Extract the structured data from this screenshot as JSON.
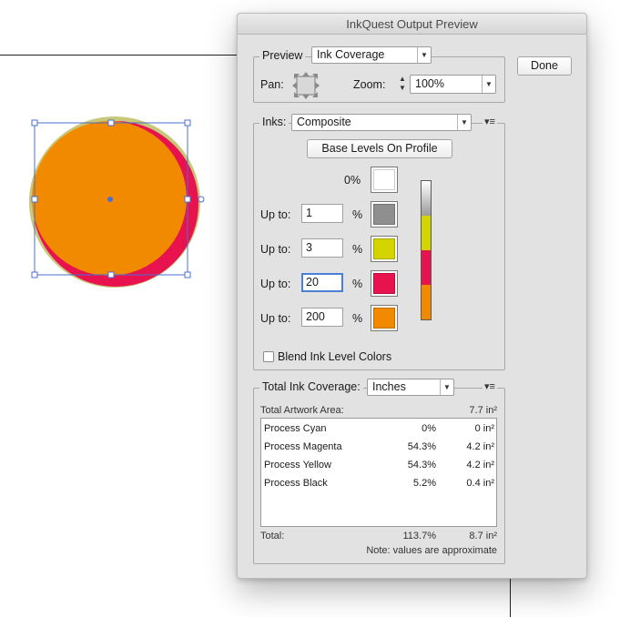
{
  "dialog": {
    "title": "InkQuest Output Preview",
    "done_label": "Done"
  },
  "preview": {
    "group_label": "Preview",
    "mode_value": "Ink Coverage",
    "pan_label": "Pan:",
    "zoom_label": "Zoom:",
    "zoom_value": "100%"
  },
  "inks": {
    "group_label": "Inks:",
    "inks_value": "Composite",
    "base_levels_label": "Base Levels On Profile",
    "zero_label": "0%",
    "levels": [
      {
        "label": "Up to:",
        "value": "1",
        "unit": "%",
        "color": "#8f8f8f"
      },
      {
        "label": "Up to:",
        "value": "3",
        "unit": "%",
        "color": "#d4d400"
      },
      {
        "label": "Up to:",
        "value": "20",
        "unit": "%",
        "color": "#e8124e"
      },
      {
        "label": "Up to:",
        "value": "200",
        "unit": "%",
        "color": "#f28a00"
      }
    ],
    "blend_label": "Blend Ink Level Colors",
    "blend_checked": false
  },
  "coverage": {
    "group_label": "Total Ink Coverage:",
    "unit_value": "Inches",
    "artwork_area_label": "Total Artwork Area:",
    "artwork_area_value": "7.7 in²",
    "rows": [
      {
        "name": "Process Cyan",
        "percent": "0%",
        "area": "0 in²"
      },
      {
        "name": "Process Magenta",
        "percent": "54.3%",
        "area": "4.2 in²"
      },
      {
        "name": "Process Yellow",
        "percent": "54.3%",
        "area": "4.2 in²"
      },
      {
        "name": "Process Black",
        "percent": "5.2%",
        "area": "0.4 in²"
      }
    ],
    "total_label": "Total:",
    "total_percent": "113.7%",
    "total_area": "8.7 in²",
    "note": "Note: values are approximate"
  },
  "icons": {
    "dropdown": "chevron-down-icon",
    "panel_menu": "panel-menu-icon",
    "pan": "pan-arrows-icon",
    "stepper": "stepper-icon"
  },
  "colors": {
    "artwork_fill": "#f28a00",
    "artwork_stroke": "#e8124e",
    "artwork_outer": "#c8c87a",
    "selection": "#4a6fd0"
  }
}
